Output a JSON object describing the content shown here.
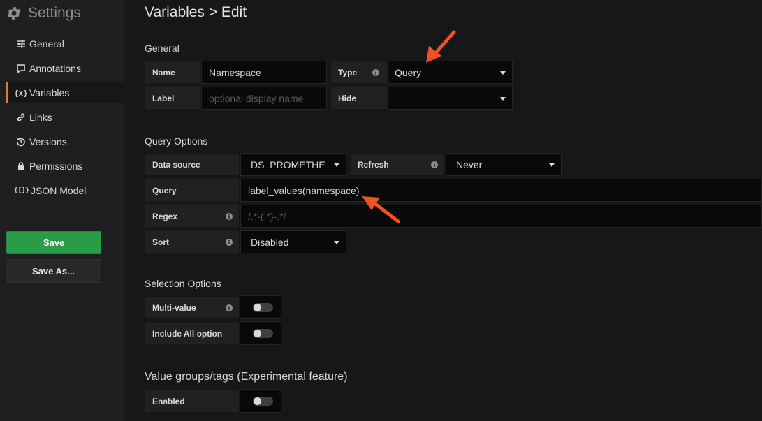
{
  "sidebar": {
    "title": "Settings",
    "items": [
      {
        "label": "General",
        "icon": "sliders-icon"
      },
      {
        "label": "Annotations",
        "icon": "comment-icon"
      },
      {
        "label": "Variables",
        "icon": "variables-icon",
        "icon_text": "{x}",
        "active": true
      },
      {
        "label": "Links",
        "icon": "link-icon"
      },
      {
        "label": "Versions",
        "icon": "history-icon"
      },
      {
        "label": "Permissions",
        "icon": "lock-icon"
      },
      {
        "label": "JSON Model",
        "icon": "json-icon",
        "icon_text": "{[]}"
      }
    ],
    "save_label": "Save",
    "save_as_label": "Save As..."
  },
  "page": {
    "title": "Variables > Edit"
  },
  "general": {
    "heading": "General",
    "name_label": "Name",
    "name_value": "Namespace",
    "type_label": "Type",
    "type_value": "Query",
    "label_label": "Label",
    "label_placeholder": "optional display name",
    "hide_label": "Hide",
    "hide_value": ""
  },
  "query_options": {
    "heading": "Query Options",
    "datasource_label": "Data source",
    "datasource_value": "DS_PROMETHE",
    "refresh_label": "Refresh",
    "refresh_value": "Never",
    "query_label": "Query",
    "query_value": "label_values(namespace)",
    "regex_label": "Regex",
    "regex_placeholder": "/.*-(.*)-.*/",
    "sort_label": "Sort",
    "sort_value": "Disabled"
  },
  "selection_options": {
    "heading": "Selection Options",
    "multi_label": "Multi-value",
    "multi_on": false,
    "include_all_label": "Include All option",
    "include_all_on": false
  },
  "value_groups": {
    "heading": "Value groups/tags (Experimental feature)",
    "enabled_label": "Enabled",
    "enabled_on": false
  },
  "colors": {
    "accent_orange": "#eb7b18",
    "save_green": "#299c46",
    "annotation_arrow": "#f4511e"
  }
}
